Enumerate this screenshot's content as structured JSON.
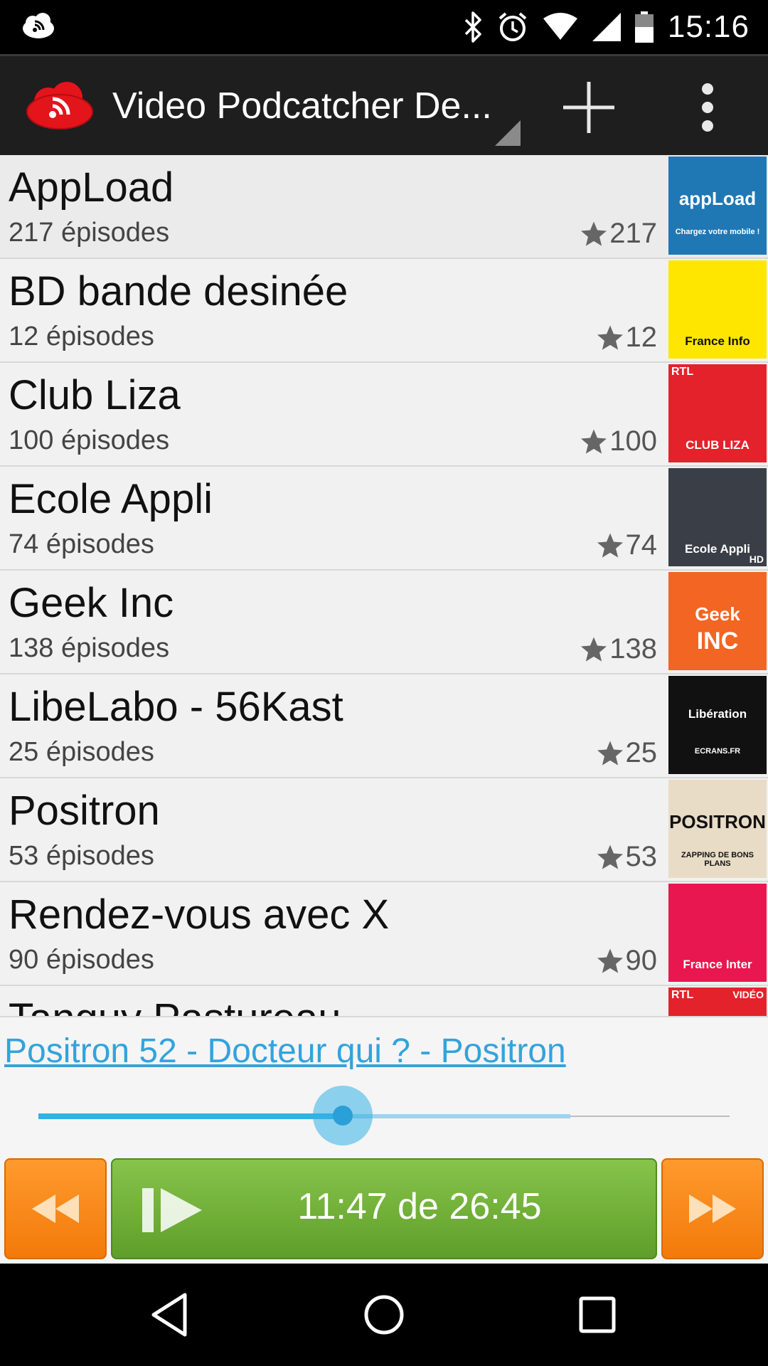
{
  "status_bar": {
    "time": "15:16",
    "icons": [
      "notification-podcast-icon",
      "bluetooth-icon",
      "alarm-icon",
      "wifi-icon",
      "signal-icon",
      "battery-icon"
    ]
  },
  "action_bar": {
    "title": "Video Podcatcher De...",
    "icons": [
      "app-logo-icon",
      "add-icon",
      "overflow-menu-icon"
    ]
  },
  "podcasts": [
    {
      "title": "AppLoad",
      "episodes": "217 épisodes",
      "rating": "217",
      "thumb": {
        "text": "appLoad",
        "sub": "Chargez votre mobile !",
        "bg": "#1f78b4"
      }
    },
    {
      "title": "BD bande desinée",
      "episodes": "12 épisodes",
      "rating": "12",
      "thumb": {
        "text": "France Info",
        "bg": "#ffe600"
      }
    },
    {
      "title": "Club Liza",
      "episodes": "100 épisodes",
      "rating": "100",
      "thumb": {
        "text": "CLUB LIZA",
        "top": "RTL",
        "bg": "#e4222b"
      }
    },
    {
      "title": "Ecole Appli",
      "episodes": "74 épisodes",
      "rating": "74",
      "thumb": {
        "text": "Ecole Appli",
        "corner": "HD",
        "bg": "#3a3f47"
      }
    },
    {
      "title": "Geek Inc",
      "episodes": "138 épisodes",
      "rating": "138",
      "thumb": {
        "text": "Geek",
        "sub": "INC",
        "bg": "#f26522"
      }
    },
    {
      "title": "LibeLabo - 56Kast",
      "episodes": "25 épisodes",
      "rating": "25",
      "thumb": {
        "text": "Libération",
        "sub": "ECRANS.FR",
        "bg": "#111111"
      }
    },
    {
      "title": "Positron",
      "episodes": "53 épisodes",
      "rating": "53",
      "thumb": {
        "text": "POSITRON",
        "sub": "ZAPPING DE BONS PLANS",
        "bg": "#e8dcc6"
      }
    },
    {
      "title": "Rendez-vous avec X",
      "episodes": "90 épisodes",
      "rating": "90",
      "thumb": {
        "text": "France Inter",
        "bg": "#e8174f"
      }
    },
    {
      "title": "Tanguy Pastureau",
      "episodes": "",
      "rating": "",
      "thumb": {
        "text": "",
        "top": "RTL",
        "corner": "VIDÉO",
        "bg": "#e4222b"
      }
    }
  ],
  "player": {
    "now_playing": "Positron 52 - Docteur qui ? - Positron",
    "time_label": "11:47 de 26:45",
    "progress_fraction": 0.44,
    "buffer_fraction": 0.77,
    "accent": "#33a3dc",
    "orange": "#f7850f",
    "green": "#72b13a",
    "buttons": [
      "rewind-icon",
      "play-pause-icon",
      "fast-forward-icon"
    ]
  },
  "nav_bar": {
    "icons": [
      "back-icon",
      "home-icon",
      "recents-icon"
    ]
  }
}
